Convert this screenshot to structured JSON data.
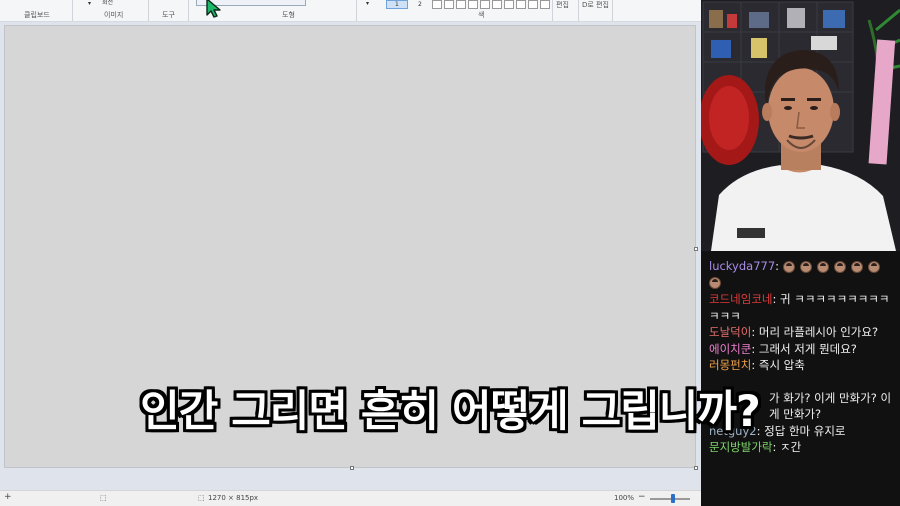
{
  "ribbon": {
    "groups": {
      "clipboard": "클립보드",
      "image": "이미지",
      "tools": "도구",
      "shapes": "도형",
      "colors": "색",
      "edit": "편집",
      "edit3d": "D로 편집"
    },
    "rotate_label": "회전",
    "color1_label": "1",
    "color2_label": "2"
  },
  "statusbar": {
    "dimensions": "1270 × 815px",
    "zoom": "100%"
  },
  "chat": {
    "messages": [
      {
        "user": "luckyda777",
        "color": "#a98ce8",
        "text": "",
        "emotes": 7
      },
      {
        "user": "코드네임코네",
        "color": "#e23b3b",
        "text": "귀 ㅋㅋㅋㅋㅋㅋㅋㅋㅋㅋㅋㅋ",
        "emotes": 0
      },
      {
        "user": "도날덕이",
        "color": "#ea6f6f",
        "text": "머리 라플레시아 인가요?",
        "emotes": 0
      },
      {
        "user": "에이치쿤",
        "color": "#ef7fd0",
        "text": "그래서 저게 뭔데요?",
        "emotes": 0
      },
      {
        "user": "러몽펀치",
        "color": "#f0a24a",
        "text": "즉시 압축",
        "emotes": 0
      },
      {
        "user": "netguy2",
        "color": "#9eb4c9",
        "text": "정답 한마 유지로",
        "emotes": 0
      },
      {
        "user": "문지방발가락",
        "color": "#7fd66a",
        "text": "ㅈ간",
        "emotes": 0
      }
    ],
    "partial_text": "가 화가? 이게 만화가? 이게 만화가?"
  },
  "subtitle": "인간 그리면 흔히 어떻게 그립니까?",
  "colors": {
    "accent": "#2a70c9"
  }
}
